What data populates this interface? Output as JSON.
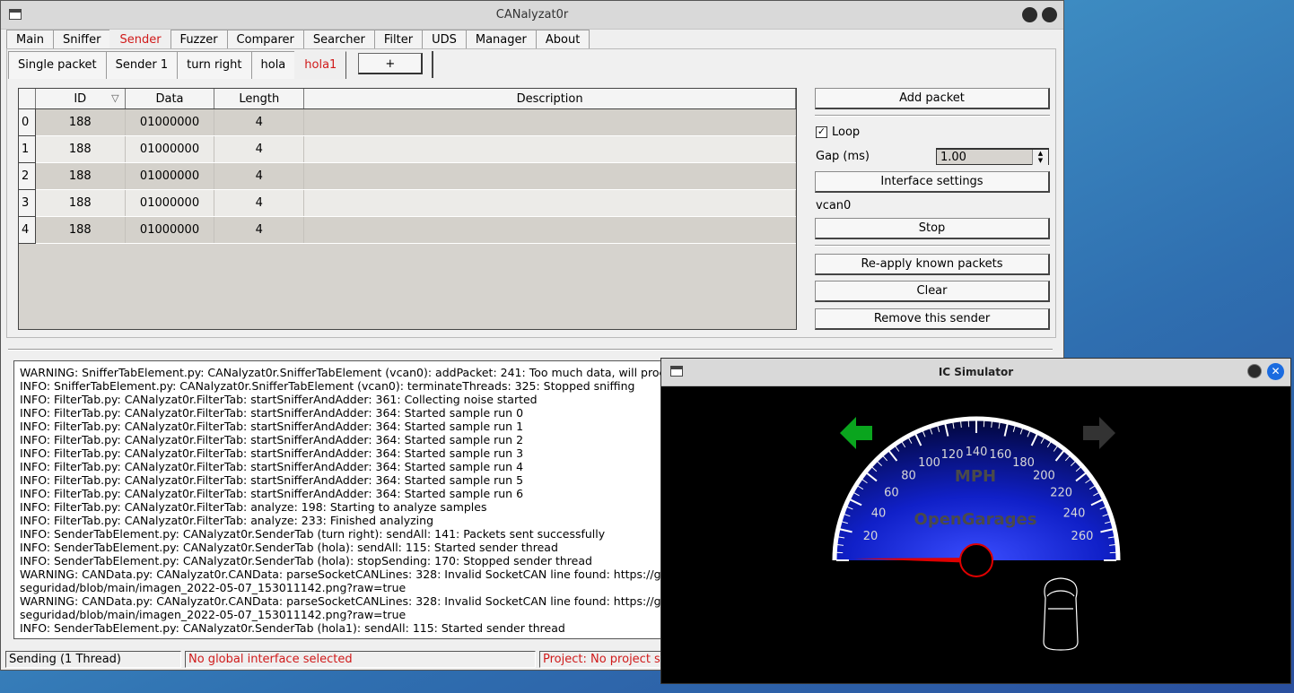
{
  "main_window": {
    "title": "CANalyzat0r",
    "tabs": [
      "Main",
      "Sniffer",
      "Sender",
      "Fuzzer",
      "Comparer",
      "Searcher",
      "Filter",
      "UDS",
      "Manager",
      "About"
    ],
    "active_tab": "Sender",
    "sender_tabs": [
      "Single packet",
      "Sender 1",
      "turn right",
      "hola",
      "hola1"
    ],
    "active_sender_tab": "hola1",
    "add_sender_label": "+",
    "table": {
      "columns": [
        "ID",
        "Data",
        "Length",
        "Description"
      ],
      "rows": [
        {
          "index": "0",
          "id": "188",
          "data": "01000000",
          "length": "4",
          "description": ""
        },
        {
          "index": "1",
          "id": "188",
          "data": "01000000",
          "length": "4",
          "description": ""
        },
        {
          "index": "2",
          "id": "188",
          "data": "01000000",
          "length": "4",
          "description": ""
        },
        {
          "index": "3",
          "id": "188",
          "data": "01000000",
          "length": "4",
          "description": ""
        },
        {
          "index": "4",
          "id": "188",
          "data": "01000000",
          "length": "4",
          "description": ""
        }
      ]
    },
    "controls": {
      "add_packet": "Add packet",
      "loop_label": "Loop",
      "loop_checked": true,
      "gap_label": "Gap (ms)",
      "gap_value": "1.00",
      "interface_settings": "Interface settings",
      "interface_name": "vcan0",
      "stop": "Stop",
      "reapply": "Re-apply known packets",
      "clear": "Clear",
      "remove_sender": "Remove this sender"
    },
    "log_lines": [
      "WARNING: SnifferTabElement.py: CANalyzat0r.SnifferTabElement (vcan0): addPacket: 241: Too much data, will process w",
      "INFO: SnifferTabElement.py: CANalyzat0r.SnifferTabElement (vcan0): terminateThreads: 325: Stopped sniffing",
      "INFO: FilterTab.py: CANalyzat0r.FilterTab: startSnifferAndAdder: 361: Collecting noise started",
      "INFO: FilterTab.py: CANalyzat0r.FilterTab: startSnifferAndAdder: 364: Started sample run 0",
      "INFO: FilterTab.py: CANalyzat0r.FilterTab: startSnifferAndAdder: 364: Started sample run 1",
      "INFO: FilterTab.py: CANalyzat0r.FilterTab: startSnifferAndAdder: 364: Started sample run 2",
      "INFO: FilterTab.py: CANalyzat0r.FilterTab: startSnifferAndAdder: 364: Started sample run 3",
      "INFO: FilterTab.py: CANalyzat0r.FilterTab: startSnifferAndAdder: 364: Started sample run 4",
      "INFO: FilterTab.py: CANalyzat0r.FilterTab: startSnifferAndAdder: 364: Started sample run 5",
      "INFO: FilterTab.py: CANalyzat0r.FilterTab: startSnifferAndAdder: 364: Started sample run 6",
      "INFO: FilterTab.py: CANalyzat0r.FilterTab: analyze: 198: Starting to analyze samples",
      "INFO: FilterTab.py: CANalyzat0r.FilterTab: analyze: 233: Finished analyzing",
      "INFO: SenderTabElement.py: CANalyzat0r.SenderTab (turn right): sendAll: 141: Packets sent successfully",
      "INFO: SenderTabElement.py: CANalyzat0r.SenderTab (hola): sendAll: 115: Started sender thread",
      "INFO: SenderTabElement.py: CANalyzat0r.SenderTab (hola): stopSending: 170: Stopped sender thread",
      "WARNING: CANData.py: CANalyzat0r.CANData: parseSocketCANLines: 328: Invalid SocketCAN line found: https://github",
      "seguridad/blob/main/imagen_2022-05-07_153011142.png?raw=true",
      "WARNING: CANData.py: CANalyzat0r.CANData: parseSocketCANLines: 328: Invalid SocketCAN line found: https://github",
      "seguridad/blob/main/imagen_2022-05-07_153011142.png?raw=true",
      "INFO: SenderTabElement.py: CANalyzat0r.SenderTab (hola1): sendAll: 115: Started sender thread"
    ],
    "status": {
      "threads": "Sending (1 Thread)",
      "interface": "No global interface selected",
      "project": "Project: No project sel"
    }
  },
  "ic_window": {
    "title": "IC Simulator",
    "speed_unit": "MPH",
    "brand": "OpenGarages",
    "speed_ticks": [
      "20",
      "40",
      "60",
      "80",
      "100",
      "120",
      "140",
      "160",
      "180",
      "200",
      "220",
      "240",
      "260"
    ],
    "speed_value": 0,
    "left_indicator_on": true,
    "right_indicator_on": false,
    "indicator_on_color": "#0aa51e",
    "indicator_off_color": "#333333",
    "needle_color": "#e00000"
  }
}
